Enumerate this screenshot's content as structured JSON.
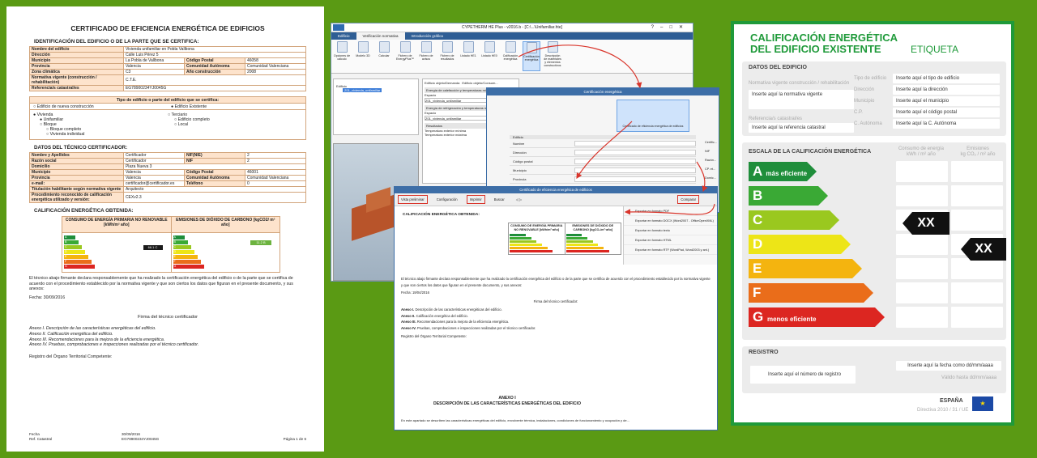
{
  "document": {
    "title": "CERTIFICADO DE EFICIENCIA ENERGÉTICA DE EDIFICIOS",
    "section1_title": "IDENTIFICACIÓN DEL EDIFICIO O DE LA PARTE QUE SE CERTIFICA:",
    "id_rows": [
      [
        "Nombre del edificio",
        "Vivienda unifamiliar en Pobla Vallbona",
        "",
        ""
      ],
      [
        "Dirección",
        "Calle Luis Pérez 5",
        "",
        ""
      ],
      [
        "Municipio",
        "La Pobla de Vallbona",
        "Código Postal",
        "46058"
      ],
      [
        "Provincia",
        "Valencia",
        "Comunidad Autónoma",
        "Comunidad Valenciana"
      ],
      [
        "Zona climática",
        "C3",
        "Año construcción",
        "2008"
      ],
      [
        "Normativa vigente (construcción / rehabilitación)",
        "C.T.E.",
        "",
        ""
      ],
      [
        "Referencia/s catastral/es",
        "EG78900234YJ0045G",
        "",
        ""
      ]
    ],
    "tipo_header": "Tipo de edificio o parte del edificio que se certifica:",
    "tipo_options": [
      "Edificio de nueva construcción",
      "Edificio Existente"
    ],
    "tipo_list_left": [
      "Vivienda",
      "Unifamiliar",
      "Bloque",
      "Bloque completo",
      "Vivienda individual"
    ],
    "tipo_list_right": [
      "Terciario",
      "Edificio completo",
      "Local"
    ],
    "section2_title": "DATOS DEL TÉCNICO CERTIFICADOR:",
    "tech_rows": [
      [
        "Nombre y Apellidos",
        "Certificador",
        "NIF(NIE)",
        "2"
      ],
      [
        "Razón social",
        "Certificador",
        "NIF",
        "2"
      ],
      [
        "Domicilio",
        "Plaza Nueva 3",
        "",
        ""
      ],
      [
        "Municipio",
        "Valencia",
        "Código Postal",
        "46001"
      ],
      [
        "Provincia",
        "Valencia",
        "Comunidad Autónoma",
        "Comunidad Valenciana"
      ],
      [
        "e-mail:",
        "certificador@certificador.es",
        "Teléfono",
        "0"
      ],
      [
        "Titulación habilitante según normativa vigente",
        "Arquitecto",
        "",
        ""
      ],
      [
        "Procedimiento reconocido de calificación energética utilizado y versión:",
        "CEXv2.3",
        "",
        ""
      ]
    ],
    "section3_title": "CALIFICACIÓN ENERGÉTICA OBTENIDA:",
    "col1_header": "CONSUMO DE ENERGÍA PRIMARIA NO RENOVABLE [kWh/m² año]",
    "col2_header": "EMISIONES DE DIÓXIDO DE CARBONO [kgCO2/ m² año]",
    "col1_value": "66.1 C",
    "col2_value": "11.2 B",
    "paragraph": "El técnico abajo firmante declara responsablemente que ha realizado la certificación energética del edificio o de la parte que se certifica de acuerdo con el procedimiento establecido por la normativa vigente y que son ciertos los datos que figuran en el presente documento, y sus anexos:",
    "fecha": "Fecha: 30/09/2016",
    "firma": "Firma del técnico certificador",
    "anexos": [
      "Anexo I. Descripción de las características energéticas del edificio.",
      "Anexo II. Calificación energética del edificio.",
      "Anexo III. Recomendaciones para la mejora de la eficiencia energética.",
      "Anexo IV. Pruebas, comprobaciones e inspecciones realizadas por el técnico certificador."
    ],
    "registro": "Registro del Órgano Territorial Competente:",
    "footer_left": [
      "Fecha",
      "Ref. Catastral"
    ],
    "footer_mid": [
      "30/09/2016",
      "EG78900234YJ0045G"
    ],
    "footer_right": "Página 1 de 6"
  },
  "app": {
    "window_title": "CYPETHERM HE Plus - v2016.b - [C:\\...\\Unifamiliar.hte]",
    "ribbon_tabs": [
      "Edificio",
      "Verificación normativa",
      "Introducción gráfica"
    ],
    "ribbon_buttons": [
      "Opciones de cálculo",
      "Modelo 3D",
      "Calcular",
      "Fichero de EnergyPlus™",
      "Fichero de avisos",
      "Fichero de resultados",
      "Listado HE1",
      "Listado HE0",
      "Calificación energética",
      "Certificación energética",
      "Descripción de materiales y elementos constructivos"
    ],
    "ribbon_group_labels": [
      "Cálculo",
      "Listados"
    ],
    "tree_root": "Edificio",
    "tree_selected": "Z01_vivienda_unifamiliar",
    "form_tabs": [
      "Edificio objeto/Demanda",
      "Edificio objeto/Consum..."
    ],
    "form_labels": [
      "Energía de calefacción y temperaturas mínimas",
      "Espacio",
      "Energía de refrigeración y temperaturas máximas",
      "Espacio",
      "Resultados"
    ],
    "form_values": [
      "Z01_vivienda_unifamiliar",
      "Z01_vivienda_unifamiliar"
    ],
    "form_rows": [
      "Temperatura exterior mínima",
      "Temperatura exterior máxima"
    ],
    "dialog1_title": "Certificación energética",
    "dialog1_button": "Certificado de eficiencia energética de edificios",
    "dialog1_section": "Edificio",
    "dialog1_fields": [
      "Nombre",
      "Dirección",
      "Código postal",
      "Municipio",
      "Provincia"
    ],
    "dialog1_right": [
      "Certific...",
      "NIF",
      "Razón...",
      "CP. et...",
      "Domic..."
    ],
    "dialog2_title": "Certificado de eficiencia energética de edificios",
    "dialog2_toolbar": [
      "Vista preliminar",
      "Configuración",
      "Imprimir",
      "Buscar"
    ],
    "dialog2_compare": "Comparar",
    "export_options": [
      "Exportar en formato PDF",
      "Exportar en formato DOCX (Word2007 - OfficeOpenXML)",
      "Exportar en formato texto",
      "Exportar en formato HTML",
      "Exportar en formato RTF (WordPad, Word2003 y ant.)"
    ],
    "cert_heading": "CALIFICACIÓN ENERGÉTICA OBTENIDA:",
    "cert_col1": "CONSUMO DE ENERGÍA PRIMARIA NO RENOVABLE [kWh/m²·año]",
    "cert_col2": "EMISIONES DE DIÓXIDO DE CARBONO [kgCO₂/m²·año]",
    "cert_para": "El técnico abajo firmante declara responsablemente que ha realizado la certificación energética del edificio o de la parte que se certifica de acuerdo con el procedimiento establecido por la normativa vigente y que son ciertos los datos que figuran en el presente documento, y sus anexos:",
    "cert_fecha": "Fecha: 19/04/2016",
    "cert_firma": "Firma del técnico certificador:",
    "cert_anexos": [
      [
        "Anexo I.",
        "Descripción de las características energéticas del edificio."
      ],
      [
        "Anexo II.",
        "Calificación energética del edificio."
      ],
      [
        "Anexo III.",
        "Recomendaciones para la mejora de la eficiencia energética."
      ],
      [
        "Anexo IV.",
        "Pruebas, comprobaciones e inspecciones realizadas por el técnico certificador."
      ]
    ],
    "cert_registro": "Registro del Órgano Territorial Competente:",
    "anexo_title": [
      "ANEXO I",
      "DESCRIPCIÓN DE LAS CARACTERÍSTICAS ENERGÉTICAS DEL EDIFICIO"
    ],
    "anexo_para": "En este apartado se describen las características energéticas del edificio, envolvente térmica, instalaciones, condiciones de funcionamiento y ocupación y de..."
  },
  "label": {
    "title": [
      "CALIFICACIÓN ENERGÉTICA",
      "DEL EDIFICIO EXISTENTE"
    ],
    "etiqueta": "ETIQUETA",
    "datos_title": "DATOS DEL EDIFICIO",
    "left_labels": [
      "Normativa vigente construcción / rehabilitación",
      "Referencia/s catastral/es"
    ],
    "left_values": [
      "Inserte aquí la normativa vigente",
      "Inserte aquí la referencia catastral"
    ],
    "right_labels": [
      "Tipo de edificio",
      "Dirección",
      "Municipio",
      "C.P.",
      "C. Autónoma"
    ],
    "right_values": [
      "Inserte aquí el tipo de edificio",
      "Inserte aquí la dirección",
      "Inserte aquí el municipio",
      "Inserte aquí el código postal",
      "Inserte aquí la C. Autónoma"
    ],
    "escala_title": "ESCALA DE LA CALIFICACIÓN ENERGÉTICA",
    "col_consumo": [
      "Consumo de energía",
      "kWh / m² año"
    ],
    "col_emisiones": [
      "Emisiones",
      "kg CO₂ / m² año"
    ],
    "grades": [
      {
        "letter": "A",
        "text": "más eficiente",
        "color": "#1f8e3b"
      },
      {
        "letter": "B",
        "text": "",
        "color": "#3aa935"
      },
      {
        "letter": "C",
        "text": "",
        "color": "#9ac81f"
      },
      {
        "letter": "D",
        "text": "",
        "color": "#ede517"
      },
      {
        "letter": "E",
        "text": "",
        "color": "#f4b40f"
      },
      {
        "letter": "F",
        "text": "",
        "color": "#ea6d1a"
      },
      {
        "letter": "G",
        "text": "menos eficiente",
        "color": "#dc2621"
      }
    ],
    "consumo_marker": "XX",
    "emisiones_marker": "XX",
    "registro_title": "REGISTRO",
    "registro_value": "Inserte aquí el número de registro",
    "fecha_value": "Inserte aquí la fecha como dd/mm/aaaa",
    "valido": "Válido hasta dd/mm/aaaa",
    "pais": "ESPAÑA",
    "directiva": "Directiva 2010 / 31 / UE"
  }
}
